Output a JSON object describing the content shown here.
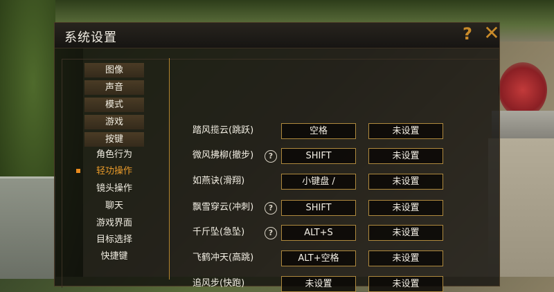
{
  "window": {
    "title": "系统设置"
  },
  "nav": {
    "categories": [
      "图像",
      "声音",
      "模式",
      "游戏",
      "按键"
    ],
    "subitems": [
      "角色行为",
      "轻功操作",
      "镜头操作",
      "聊天",
      "游戏界面",
      "目标选择",
      "快捷键"
    ],
    "active_subitem": "轻功操作"
  },
  "bindings": [
    {
      "action": "踏风揽云(跳跃)",
      "help": false,
      "primary": "空格",
      "secondary": "未设置"
    },
    {
      "action": "微风拂柳(撤步)",
      "help": true,
      "primary": "SHIFT",
      "secondary": "未设置"
    },
    {
      "action": "如燕诀(滑翔)",
      "help": false,
      "primary": "小键盘 /",
      "secondary": "未设置"
    },
    {
      "action": "飘雪穿云(冲刺)",
      "help": true,
      "primary": "SHIFT",
      "secondary": "未设置"
    },
    {
      "action": "千斤坠(急坠)",
      "help": true,
      "primary": "ALT+S",
      "secondary": "未设置"
    },
    {
      "action": "飞鹤冲天(高跳)",
      "help": false,
      "primary": "ALT+空格",
      "secondary": "未设置"
    },
    {
      "action": "追风步(快跑)",
      "help": false,
      "primary": "未设置",
      "secondary": "未设置"
    }
  ],
  "icons": {
    "help": "help-icon",
    "close": "close-icon",
    "row_help": "question-circle-icon"
  },
  "colors": {
    "accent": "#e88a1e",
    "border": "#b08a3e",
    "text": "#f3efe4"
  }
}
